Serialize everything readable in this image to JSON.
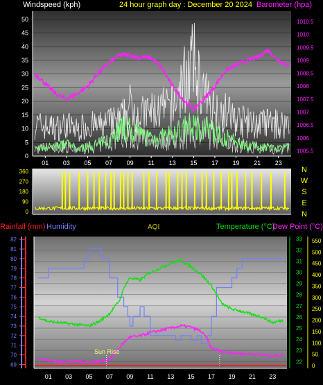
{
  "header": {
    "left_title": "Windspeed (kph)",
    "center_title": "24 hour graph day : December 20 2024",
    "right_title": "Barometer (hpa)"
  },
  "panel3_labels": {
    "rainfall": "Rainfall (mm)",
    "humidity": "Humidity",
    "aqi": "AQI",
    "temperature": "Temperature (°C)",
    "dewpoint": "Dew Point (°C)",
    "sunrise": "Sun Rise"
  },
  "colors": {
    "wind": "#ffffff",
    "gust_fill": "#e8e8e8",
    "wind_green": "#7cff7c",
    "barometer": "#ff20ff",
    "direction": "#ffff00",
    "temperature": "#10e010",
    "humidity": "#7080ff",
    "dewpoint": "#ff20ff",
    "rainfall": "#ff2020",
    "aqi": "#c8c800"
  },
  "chart_data": [
    {
      "type": "line",
      "name": "wind-barometer",
      "x_ticks": [
        "01",
        "03",
        "05",
        "07",
        "09",
        "11",
        "13",
        "15",
        "17",
        "19",
        "21",
        "23"
      ],
      "y_left_ticks": [
        0,
        5,
        10,
        15,
        20,
        25,
        30,
        35,
        40,
        45,
        50
      ],
      "y_left_range": [
        0,
        53
      ],
      "y_right_ticks": [
        "1005.5",
        "1006",
        "1006.5",
        "1007",
        "1007.5",
        "1008",
        "1008.5",
        "1009",
        "1009.5",
        "1010",
        "1010.5"
      ],
      "y_right_range": [
        1005.3,
        1010.9
      ],
      "series": [
        {
          "key": "wind_gust_upper",
          "x": [
            0,
            1,
            2,
            3,
            4,
            5,
            6,
            7,
            8,
            9,
            10,
            11,
            12,
            13,
            14,
            15,
            16,
            17,
            18,
            19,
            20,
            21,
            22,
            23,
            24
          ],
          "values": [
            17,
            16,
            15,
            17,
            14,
            17,
            16,
            18,
            19,
            27,
            22,
            24,
            25,
            26,
            40,
            50,
            32,
            26,
            24,
            20,
            18,
            17,
            18,
            17,
            18
          ]
        },
        {
          "key": "wind_avg",
          "x": [
            0,
            1,
            2,
            3,
            4,
            5,
            6,
            7,
            8,
            9,
            10,
            11,
            12,
            13,
            14,
            15,
            16,
            17,
            18,
            19,
            20,
            21,
            22,
            23,
            24
          ],
          "values": [
            3,
            4,
            4,
            5,
            3,
            4,
            5,
            7,
            12,
            11,
            9,
            8,
            8,
            9,
            11,
            13,
            12,
            10,
            8,
            6,
            5,
            4,
            4,
            3,
            4
          ]
        },
        {
          "key": "barometer",
          "x": [
            0,
            1,
            2,
            3,
            4,
            5,
            6,
            7,
            8,
            9,
            10,
            11,
            12,
            13,
            14,
            15,
            16,
            17,
            18,
            19,
            20,
            21,
            22,
            23,
            24
          ],
          "values": [
            1008.5,
            1008.1,
            1007.7,
            1007.5,
            1007.7,
            1008.0,
            1008.5,
            1008.9,
            1009.2,
            1009.2,
            1009.1,
            1009.1,
            1008.7,
            1008.0,
            1007.5,
            1007.1,
            1007.5,
            1008.0,
            1008.6,
            1008.8,
            1009.0,
            1009.1,
            1009.4,
            1009.0,
            1008.8
          ]
        }
      ]
    },
    {
      "type": "line",
      "name": "wind-direction",
      "x_ticks": [
        "01",
        "03",
        "05",
        "07",
        "09",
        "11",
        "13",
        "15",
        "17",
        "19",
        "21",
        "23"
      ],
      "y_ticks": [
        0,
        90,
        180,
        270,
        360
      ],
      "compass": [
        "N",
        "W",
        "S",
        "E",
        "N"
      ],
      "spike_hours": [
        2.6,
        2.9,
        3.3,
        4.2,
        5.0,
        5.6,
        6.1,
        6.7,
        7.2,
        7.5,
        8.1,
        8.4,
        8.8,
        9.2,
        10.3,
        10.8,
        11.5,
        12.4,
        12.7,
        13.5,
        13.9,
        14.3,
        15.1,
        15.8,
        16.2,
        16.9,
        17.6,
        18.3,
        18.6,
        19.1,
        19.9,
        20.5,
        21.4,
        22.3,
        23.6
      ],
      "baseline_degrees": 30
    },
    {
      "type": "line",
      "name": "temp-humidity",
      "x_ticks": [
        "01",
        "03",
        "05",
        "07",
        "09",
        "11",
        "13",
        "15",
        "17",
        "19",
        "21",
        "23"
      ],
      "humidity_ticks": [
        69,
        70,
        71,
        72,
        73,
        74,
        75,
        76,
        77,
        78,
        79,
        80,
        81,
        82
      ],
      "rain_ticks": [
        0,
        50,
        100,
        150,
        200,
        250,
        300,
        350,
        400,
        450,
        500,
        550
      ],
      "temp_ticks": [
        22,
        23,
        24,
        25,
        26,
        27,
        28,
        29,
        30,
        31,
        32,
        33
      ],
      "series": [
        {
          "key": "humidity",
          "x": [
            0,
            1,
            2,
            3,
            4,
            4.5,
            5,
            5.6,
            6.2,
            7,
            7.8,
            8.4,
            8.8,
            9.0,
            9.3,
            10,
            10.4,
            11,
            12,
            13,
            13.5,
            14,
            15,
            15.6,
            16,
            16.6,
            17,
            17.5,
            18,
            19,
            19.5,
            20,
            21,
            21.5,
            22,
            23,
            24
          ],
          "values": [
            78,
            79,
            79,
            79,
            79,
            80,
            81,
            81,
            80,
            78,
            76,
            75,
            74,
            73,
            74,
            75,
            74,
            72,
            72,
            72,
            71.5,
            72,
            71.5,
            72,
            71.2,
            72,
            74,
            77,
            77,
            78,
            79,
            80,
            80,
            80,
            80,
            80,
            80
          ]
        },
        {
          "key": "temperature",
          "x": [
            0,
            1,
            2,
            3,
            4,
            5,
            6,
            7,
            8,
            8.5,
            9,
            10,
            11,
            12,
            13,
            14,
            15,
            16,
            17,
            18,
            19,
            20,
            21,
            22,
            23,
            24
          ],
          "values": [
            26.0,
            25.6,
            25.5,
            25.4,
            25.3,
            25.2,
            25.6,
            26.3,
            27.5,
            28.8,
            29.5,
            29.3,
            30.0,
            30.4,
            30.8,
            31.1,
            30.5,
            29.8,
            28.8,
            27.2,
            26.7,
            26.5,
            26.2,
            26.0,
            25.5,
            25.7
          ]
        },
        {
          "key": "dewpoint",
          "x": [
            0,
            1,
            2,
            3,
            4,
            5,
            6,
            7,
            7.6,
            8.2,
            9,
            10,
            11,
            12,
            13,
            14,
            15,
            16,
            16.6,
            17,
            18,
            19,
            20,
            21,
            22,
            23,
            24
          ],
          "values": [
            22.3,
            22.1,
            22.0,
            22.0,
            22.0,
            22.0,
            22.0,
            22.2,
            22.8,
            23.5,
            24.2,
            24.3,
            24.6,
            24.8,
            25.0,
            25.2,
            25.1,
            24.7,
            24.0,
            23.2,
            22.9,
            22.8,
            22.7,
            22.7,
            22.6,
            22.5,
            22.6
          ]
        },
        {
          "key": "rainfall",
          "x": [
            0,
            24
          ],
          "values": [
            0,
            0
          ]
        }
      ]
    }
  ]
}
